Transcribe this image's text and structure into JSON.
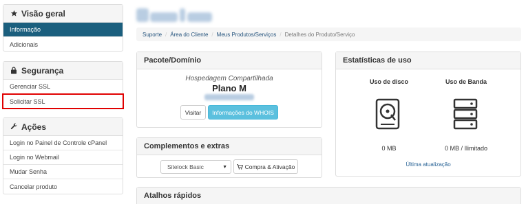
{
  "sidebar": {
    "overview": {
      "title": "Visão geral",
      "icon": "star-icon",
      "items": [
        {
          "label": "Informação",
          "active": true
        },
        {
          "label": "Adicionais",
          "active": false
        }
      ]
    },
    "security": {
      "title": "Segurança",
      "icon": "lock-icon",
      "items": [
        {
          "label": "Gerenciar SSL"
        },
        {
          "label": "Solicitar SSL"
        }
      ]
    },
    "actions": {
      "title": "Ações",
      "icon": "wrench-icon",
      "items": [
        {
          "label": "Login no Painel de Controle cPanel"
        },
        {
          "label": "Login no Webmail"
        },
        {
          "label": "Mudar Senha"
        },
        {
          "label": "Cancelar produto"
        }
      ]
    }
  },
  "breadcrumb": {
    "items": [
      "Suporte",
      "Área do Cliente",
      "Meus Produtos/Serviços"
    ],
    "current": "Detalhes do Produto/Serviço"
  },
  "package": {
    "title": "Pacote/Domínio",
    "group": "Hospedagem Compartilhada",
    "name": "Plano M",
    "visit_label": "Visitar",
    "whois_label": "Informações do WHOIS"
  },
  "addons": {
    "title": "Complementos e extras",
    "selected_option": "Sitelock Basic",
    "buy_label": "Compra & Ativação"
  },
  "quick": {
    "title": "Atalhos rápidos"
  },
  "stats": {
    "title": "Estatísticas de uso",
    "disk_label": "Uso de disco",
    "disk_value": "0 MB",
    "bandwidth_label": "Uso de Banda",
    "bandwidth_value": "0 MB / Ilimitado",
    "last_update": "Última atualização"
  },
  "colors": {
    "active": "#1b5f7e",
    "highlight": "#e00000",
    "info_button": "#5bc0de",
    "link": "#23527c"
  }
}
